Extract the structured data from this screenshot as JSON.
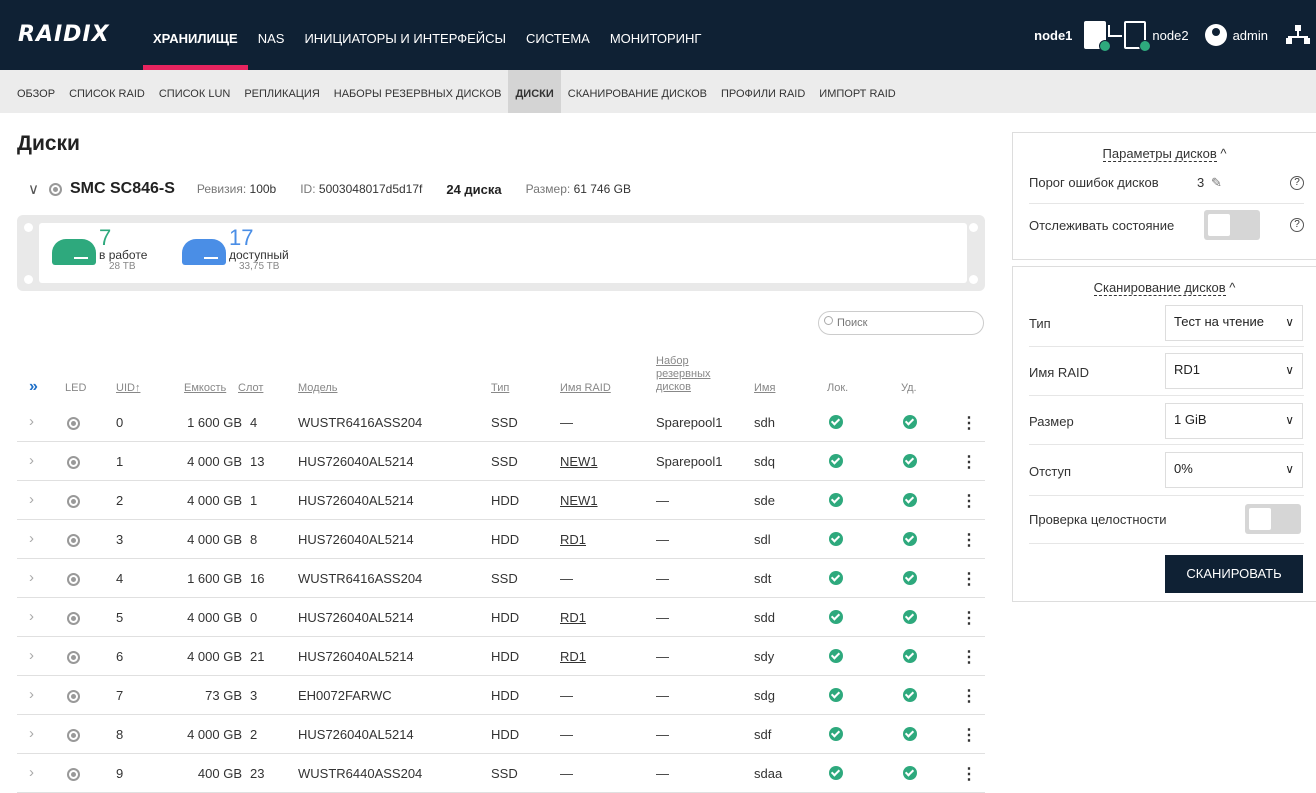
{
  "app": {
    "logo": "RAIDIX"
  },
  "main_nav": [
    {
      "label": "ХРАНИЛИЩЕ",
      "active": true
    },
    {
      "label": "NAS",
      "active": false
    },
    {
      "label": "ИНИЦИАТОРЫ И ИНТЕРФЕЙСЫ",
      "active": false
    },
    {
      "label": "СИСТЕМА",
      "active": false
    },
    {
      "label": "МОНИТОРИНГ",
      "active": false
    }
  ],
  "top_right": {
    "node1": "node1",
    "node2": "node2",
    "user": "admin"
  },
  "sub_nav": [
    {
      "label": "ОБЗОР",
      "active": false
    },
    {
      "label": "СПИСОК RAID",
      "active": false
    },
    {
      "label": "СПИСОК LUN",
      "active": false
    },
    {
      "label": "РЕПЛИКАЦИЯ",
      "active": false
    },
    {
      "label": "НАБОРЫ РЕЗЕРВНЫХ ДИСКОВ",
      "active": false
    },
    {
      "label": "ДИСКИ",
      "active": true
    },
    {
      "label": "СКАНИРОВАНИЕ ДИСКОВ",
      "active": false
    },
    {
      "label": "ПРОФИЛИ RAID",
      "active": false
    },
    {
      "label": "ИМПОРТ RAID",
      "active": false
    }
  ],
  "page": {
    "title": "Диски"
  },
  "enclosure": {
    "name": "SMC SC846-S",
    "revision_label": "Ревизия:",
    "revision": "100b",
    "id_label": "ID:",
    "id": "5003048017d5d17f",
    "disk_count": "24 диска",
    "size_label": "Размер:",
    "size": "61 746 GB"
  },
  "disk_stats": [
    {
      "count": "7",
      "label": "в работе",
      "size": "28 TB",
      "color": "#2ea97d"
    },
    {
      "count": "17",
      "label": "доступный",
      "size": "33,75 TB",
      "color": "#4a8ee6"
    }
  ],
  "search": {
    "placeholder": "Поиск"
  },
  "table": {
    "headers": {
      "led": "LED",
      "uid": "UID↑",
      "capacity": "Емкость",
      "slot": "Слот",
      "model": "Модель",
      "type": "Тип",
      "raid": "Имя RAID",
      "spare_1": "Набор",
      "spare_2": "резервных",
      "spare_3": "дисков",
      "name": "Имя",
      "loc": "Лок.",
      "rem": "Уд."
    },
    "rows": [
      {
        "uid": "0",
        "capacity": "1 600 GB",
        "slot": "4",
        "model": "WUSTR6416ASS204",
        "type": "SSD",
        "raid": "—",
        "raid_link": false,
        "spare": "Sparepool1",
        "name": "sdh"
      },
      {
        "uid": "1",
        "capacity": "4 000 GB",
        "slot": "13",
        "model": "HUS726040AL5214",
        "type": "SSD",
        "raid": "NEW1",
        "raid_link": true,
        "spare": "Sparepool1",
        "name": "sdq"
      },
      {
        "uid": "2",
        "capacity": "4 000 GB",
        "slot": "1",
        "model": "HUS726040AL5214",
        "type": "HDD",
        "raid": "NEW1",
        "raid_link": true,
        "spare": "—",
        "name": "sde"
      },
      {
        "uid": "3",
        "capacity": "4 000 GB",
        "slot": "8",
        "model": "HUS726040AL5214",
        "type": "HDD",
        "raid": "RD1",
        "raid_link": true,
        "spare": "—",
        "name": "sdl"
      },
      {
        "uid": "4",
        "capacity": "1 600 GB",
        "slot": "16",
        "model": "WUSTR6416ASS204",
        "type": "SSD",
        "raid": "—",
        "raid_link": false,
        "spare": "—",
        "name": "sdt"
      },
      {
        "uid": "5",
        "capacity": "4 000 GB",
        "slot": "0",
        "model": "HUS726040AL5214",
        "type": "HDD",
        "raid": "RD1",
        "raid_link": true,
        "spare": "—",
        "name": "sdd"
      },
      {
        "uid": "6",
        "capacity": "4 000 GB",
        "slot": "21",
        "model": "HUS726040AL5214",
        "type": "HDD",
        "raid": "RD1",
        "raid_link": true,
        "spare": "—",
        "name": "sdy"
      },
      {
        "uid": "7",
        "capacity": "73 GB",
        "slot": "3",
        "model": "EH0072FARWC",
        "type": "HDD",
        "raid": "—",
        "raid_link": false,
        "spare": "—",
        "name": "sdg"
      },
      {
        "uid": "8",
        "capacity": "4 000 GB",
        "slot": "2",
        "model": "HUS726040AL5214",
        "type": "HDD",
        "raid": "—",
        "raid_link": false,
        "spare": "—",
        "name": "sdf"
      },
      {
        "uid": "9",
        "capacity": "400 GB",
        "slot": "23",
        "model": "WUSTR6440ASS204",
        "type": "SSD",
        "raid": "—",
        "raid_link": false,
        "spare": "—",
        "name": "sdaa"
      }
    ]
  },
  "disk_params": {
    "title": "Параметры дисков",
    "error_threshold_label": "Порог ошибок дисков",
    "error_threshold_value": "3",
    "monitor_label": "Отслеживать состояние"
  },
  "disk_scan": {
    "title": "Сканирование дисков",
    "type_label": "Тип",
    "type_value": "Тест на чтение",
    "raid_label": "Имя RAID",
    "raid_value": "RD1",
    "size_label": "Размер",
    "size_value": "1 GiB",
    "offset_label": "Отступ",
    "offset_value": "0%",
    "integrity_label": "Проверка целостности",
    "button": "СКАНИРОВАТЬ"
  }
}
